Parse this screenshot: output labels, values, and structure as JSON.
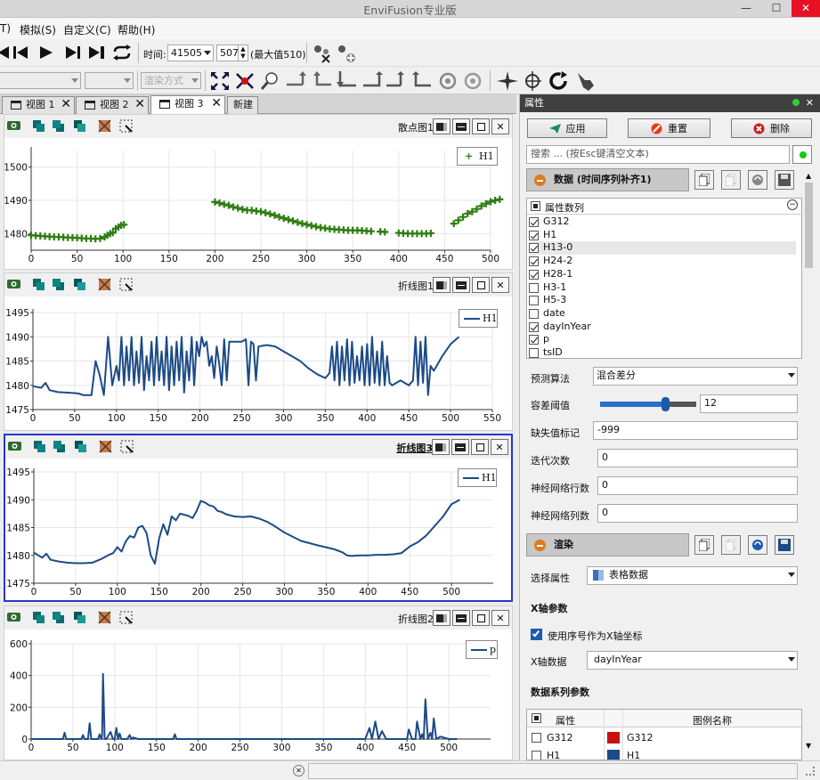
{
  "window": {
    "title": "EnviFusion专业版"
  },
  "menu": {
    "items": [
      "T)",
      "模拟(S)",
      "自定义(C)",
      "帮助(H)"
    ]
  },
  "toolbar": {
    "time_label": "时间:",
    "time_value": "41505",
    "step_value": "507",
    "max_label": "(最大值510)",
    "render_mode": "渲染方式"
  },
  "tabs": [
    {
      "label": "视图 1"
    },
    {
      "label": "视图 2"
    },
    {
      "label": "视图 3"
    },
    {
      "label": "新建"
    }
  ],
  "panes": [
    {
      "title": "散点图1"
    },
    {
      "title": "折线图1"
    },
    {
      "title": "折线图3"
    },
    {
      "title": "折线图2"
    }
  ],
  "chart_data": [
    {
      "type": "scatter",
      "title": "散点图1",
      "xlim": [
        0,
        500
      ],
      "ylim": [
        1475,
        1505
      ],
      "x_ticks": [
        0,
        50,
        100,
        150,
        200,
        250,
        300,
        350,
        400,
        450,
        500
      ],
      "y_ticks": [
        1480,
        1490,
        1500
      ],
      "series": [
        {
          "name": "H1",
          "color": "#2f7d10",
          "marker": "+",
          "x": [
            0,
            5,
            10,
            15,
            20,
            25,
            30,
            35,
            40,
            45,
            50,
            55,
            60,
            65,
            70,
            75,
            80,
            83,
            86,
            89,
            92,
            95,
            98,
            101,
            200,
            205,
            210,
            215,
            220,
            225,
            230,
            235,
            240,
            245,
            250,
            255,
            260,
            265,
            270,
            275,
            280,
            285,
            290,
            295,
            300,
            305,
            310,
            315,
            320,
            325,
            330,
            335,
            340,
            345,
            350,
            355,
            360,
            365,
            370,
            380,
            385,
            400,
            405,
            410,
            415,
            420,
            425,
            430,
            435,
            460,
            465,
            470,
            475,
            480,
            485,
            490,
            495,
            500,
            505,
            510
          ],
          "y": [
            1479.5,
            1479.4,
            1479.3,
            1479.2,
            1479.1,
            1479,
            1479,
            1478.9,
            1478.8,
            1478.8,
            1478.7,
            1478.6,
            1478.5,
            1478.5,
            1478.4,
            1478.5,
            1479,
            1479.5,
            1480,
            1480.3,
            1481.5,
            1482,
            1482.5,
            1482.7,
            1489.5,
            1489.2,
            1488.8,
            1488.5,
            1488,
            1487.7,
            1487.3,
            1487,
            1487,
            1486.8,
            1486.6,
            1486.3,
            1485.9,
            1485.5,
            1485,
            1484.6,
            1484.2,
            1483.8,
            1483.4,
            1483,
            1482.7,
            1482.4,
            1482.1,
            1481.8,
            1481.6,
            1481.4,
            1481.3,
            1481.2,
            1481.1,
            1481,
            1481,
            1481,
            1480.9,
            1480.8,
            1480.7,
            1480.6,
            1480.5,
            1480.2,
            1480.1,
            1480,
            1480,
            1480,
            1480,
            1480,
            1480.1,
            1483,
            1484,
            1485,
            1486,
            1486.6,
            1487.4,
            1488.3,
            1489,
            1489.6,
            1490,
            1490.3
          ]
        }
      ]
    },
    {
      "type": "line",
      "title": "折线图1",
      "xlim": [
        0,
        550
      ],
      "ylim": [
        1475,
        1495
      ],
      "x_ticks": [
        0,
        50,
        100,
        150,
        200,
        250,
        300,
        350,
        400,
        450,
        500,
        550
      ],
      "y_ticks": [
        1475,
        1480,
        1485,
        1490,
        1495
      ],
      "series": [
        {
          "name": "H1",
          "color": "#1c4b86",
          "x": [
            0,
            10,
            15,
            20,
            30,
            40,
            50,
            55,
            60,
            70,
            75,
            80,
            85,
            90,
            95,
            100,
            103,
            106,
            109,
            112,
            115,
            118,
            121,
            124,
            127,
            130,
            133,
            136,
            139,
            142,
            145,
            148,
            151,
            154,
            157,
            160,
            163,
            166,
            169,
            172,
            175,
            178,
            181,
            184,
            187,
            190,
            193,
            196,
            199,
            202,
            205,
            208,
            211,
            214,
            217,
            220,
            223,
            226,
            229,
            232,
            235,
            240,
            250,
            255,
            258,
            261,
            264,
            267,
            270,
            280,
            290,
            300,
            310,
            320,
            330,
            340,
            350,
            355,
            358,
            361,
            364,
            367,
            370,
            373,
            376,
            379,
            382,
            385,
            388,
            391,
            394,
            397,
            400,
            403,
            406,
            409,
            412,
            415,
            418,
            421,
            424,
            427,
            430,
            440,
            450,
            455,
            458,
            461,
            464,
            467,
            470,
            473,
            476,
            480,
            490,
            500,
            510
          ],
          "y": [
            1479.8,
            1479.5,
            1480.5,
            1479,
            1478.6,
            1478.5,
            1478.4,
            1478.3,
            1478,
            1478,
            1485,
            1482,
            1478,
            1490,
            1480,
            1484,
            1481,
            1490,
            1480,
            1488,
            1481,
            1490,
            1480,
            1487,
            1480.5,
            1490,
            1479,
            1486,
            1481,
            1489,
            1480,
            1490,
            1481,
            1487,
            1480,
            1490,
            1479,
            1488,
            1480,
            1489,
            1481,
            1490,
            1478.5,
            1487,
            1481,
            1490,
            1480,
            1489,
            1486,
            1490,
            1488,
            1489,
            1484,
            1486,
            1481.5,
            1488,
            1484.5,
            1480,
            1489.5,
            1481,
            1489,
            1489,
            1489,
            1489.5,
            1480,
            1489,
            1488.5,
            1481,
            1488,
            1488.3,
            1488,
            1487,
            1486,
            1485,
            1483.5,
            1482.3,
            1481.5,
            1482.5,
            1488,
            1481,
            1489,
            1480,
            1488,
            1481,
            1489.5,
            1480,
            1489,
            1480.5,
            1486,
            1481,
            1488,
            1480,
            1488.5,
            1480,
            1490,
            1480.5,
            1487,
            1480,
            1489,
            1480,
            1486,
            1480.5,
            1480,
            1481,
            1480,
            1481,
            1490,
            1480,
            1489,
            1480.5,
            1490,
            1478,
            1484,
            1483,
            1486,
            1488.5,
            1490
          ]
        }
      ]
    },
    {
      "type": "line",
      "title": "折线图3",
      "xlim": [
        0,
        550
      ],
      "ylim": [
        1475,
        1495
      ],
      "x_ticks": [
        0,
        50,
        100,
        150,
        200,
        250,
        300,
        350,
        400,
        450,
        500
      ],
      "y_ticks": [
        1475,
        1480,
        1485,
        1490,
        1495
      ],
      "series": [
        {
          "name": "H1",
          "color": "#1c4b86",
          "x": [
            0,
            10,
            15,
            20,
            30,
            40,
            50,
            60,
            70,
            80,
            90,
            95,
            100,
            105,
            110,
            115,
            120,
            125,
            130,
            135,
            140,
            145,
            150,
            155,
            160,
            165,
            170,
            175,
            180,
            185,
            190,
            195,
            200,
            205,
            210,
            215,
            220,
            225,
            230,
            240,
            250,
            260,
            270,
            280,
            290,
            300,
            320,
            340,
            360,
            370,
            375,
            380,
            390,
            400,
            410,
            420,
            430,
            440,
            450,
            460,
            470,
            480,
            490,
            500,
            510
          ],
          "y": [
            1480.5,
            1479.6,
            1480.3,
            1479.2,
            1478.9,
            1478.7,
            1478.6,
            1478.6,
            1478.7,
            1479.3,
            1480.1,
            1480.4,
            1481.5,
            1480.7,
            1482.5,
            1483.5,
            1483.2,
            1485,
            1485.3,
            1484,
            1480,
            1478.5,
            1483,
            1485.6,
            1483.7,
            1487,
            1486.3,
            1487.5,
            1487.3,
            1487.1,
            1486.7,
            1488,
            1489.8,
            1489.5,
            1489,
            1488.8,
            1488,
            1487.8,
            1487.4,
            1487,
            1486.9,
            1487,
            1486.6,
            1486,
            1485.1,
            1484.1,
            1482.6,
            1481.8,
            1481.1,
            1480.5,
            1480,
            1479.9,
            1480,
            1480,
            1480.1,
            1480.1,
            1480.2,
            1480.4,
            1481.6,
            1482.4,
            1483.6,
            1485.3,
            1487,
            1489.2,
            1490
          ]
        }
      ]
    },
    {
      "type": "line",
      "title": "折线图2",
      "xlim": [
        0,
        550
      ],
      "ylim": [
        0,
        600
      ],
      "x_ticks": [
        0,
        50,
        100,
        150,
        200,
        250,
        300,
        350,
        400,
        450,
        500
      ],
      "y_ticks": [
        0,
        200,
        400,
        600
      ],
      "series": [
        {
          "name": "p",
          "color": "#1c4b86",
          "x": [
            0,
            38,
            40,
            42,
            48,
            60,
            62,
            64,
            68,
            70,
            72,
            80,
            82,
            84,
            85,
            86,
            88,
            90,
            95,
            98,
            100,
            102,
            104,
            106,
            108,
            110,
            115,
            118,
            120,
            122,
            128,
            130,
            140,
            160,
            170,
            172,
            174,
            180,
            200,
            230,
            290,
            300,
            400,
            405,
            408,
            412,
            416,
            420,
            425,
            440,
            450,
            452,
            456,
            460,
            462,
            466,
            468,
            470,
            472,
            475,
            478,
            480,
            482,
            485,
            490,
            500,
            510
          ],
          "y": [
            0,
            0,
            40,
            0,
            0,
            0,
            25,
            0,
            0,
            100,
            0,
            0,
            30,
            0,
            20,
            410,
            0,
            0,
            45,
            0,
            0,
            70,
            0,
            35,
            0,
            0,
            0,
            25,
            0,
            10,
            0,
            0,
            0,
            0,
            0,
            30,
            0,
            0,
            0,
            0,
            0,
            0,
            0,
            70,
            0,
            110,
            0,
            50,
            0,
            0,
            0,
            60,
            0,
            0,
            110,
            0,
            30,
            0,
            250,
            0,
            40,
            0,
            130,
            0,
            15,
            0,
            0
          ]
        }
      ]
    }
  ],
  "props": {
    "header": "属性",
    "apply": "应用",
    "reset": "重置",
    "delete": "删除",
    "search_placeholder": "搜索 ... (按Esc键清空文本)",
    "data_section": "数据 (时间序列补齐1)",
    "columns_header": "属性数列",
    "columns": [
      {
        "name": "G312",
        "checked": true
      },
      {
        "name": "H1",
        "checked": true
      },
      {
        "name": "H13-0",
        "checked": true
      },
      {
        "name": "H24-2",
        "checked": true
      },
      {
        "name": "H28-1",
        "checked": true
      },
      {
        "name": "H3-1",
        "checked": false
      },
      {
        "name": "H5-3",
        "checked": false
      },
      {
        "name": "date",
        "checked": false
      },
      {
        "name": "dayInYear",
        "checked": true
      },
      {
        "name": "p",
        "checked": true
      },
      {
        "name": "tsID",
        "checked": false
      }
    ],
    "algorithm_label": "预测算法",
    "algorithm_value": "混合差分",
    "tolerance_label": "容差阈值",
    "tolerance_value": "12",
    "tolerance_level": 0.68,
    "missing_label": "缺失值标记",
    "missing_value": "-999",
    "iter_label": "迭代次数",
    "iter_value": "0",
    "nn_rows_label": "神经网络行数",
    "nn_rows_value": "0",
    "nn_cols_label": "神经网络列数",
    "nn_cols_value": "0",
    "render_section": "渲染",
    "select_prop_label": "选择属性",
    "select_prop_value": "表格数据",
    "x_axis_header": "X轴参数",
    "use_index_label": "使用序号作为X轴坐标",
    "x_data_label": "X轴数据",
    "x_data_value": "dayInYear",
    "series_header": "数据系列参数",
    "series_table_col1": "属性",
    "series_table_col2": "图例名称",
    "series_rows": [
      {
        "name": "G312",
        "color": "#c81010",
        "legend": "G312"
      },
      {
        "name": "H1",
        "color": "#1c4b86",
        "legend": "H1"
      }
    ]
  }
}
